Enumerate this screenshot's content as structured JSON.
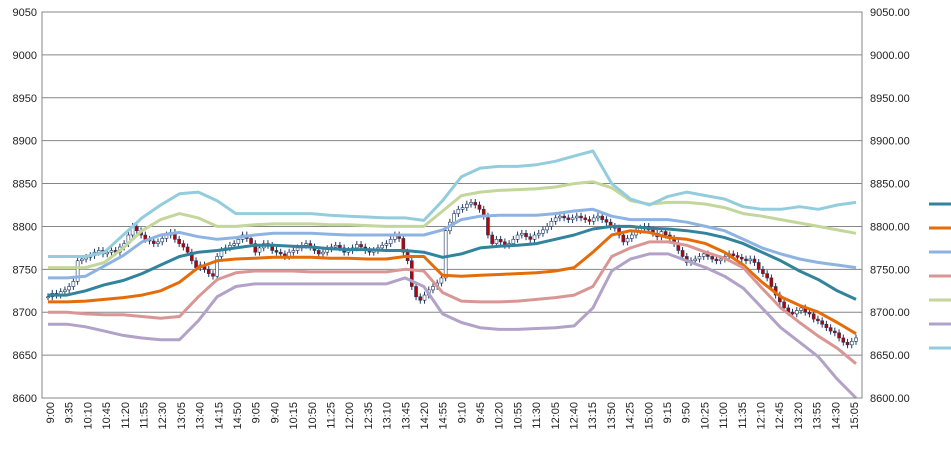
{
  "chart_data": {
    "type": "line",
    "title": "",
    "xlabel": "",
    "ylabel": "",
    "ylim": [
      8600,
      9050
    ],
    "grid": true,
    "legend": "right",
    "y_ticks_left": [
      "8600",
      "8650",
      "8700",
      "8750",
      "8800",
      "8850",
      "8900",
      "8950",
      "9000",
      "9050"
    ],
    "y_ticks_right": [
      "8600.00",
      "8650.00",
      "8700.00",
      "8750.00",
      "8800.00",
      "8850.00",
      "8900.00",
      "8950.00",
      "9000.00",
      "9050.00"
    ],
    "x_tick_labels": [
      "9:00",
      "9:35",
      "10:10",
      "10:45",
      "11:20",
      "11:55",
      "12:30",
      "13:05",
      "13:40",
      "14:15",
      "14:50",
      "9:05",
      "9:40",
      "10:15",
      "10:50",
      "11:25",
      "12:00",
      "12:35",
      "13:10",
      "13:45",
      "14:20",
      "14:55",
      "9:10",
      "9:45",
      "10:20",
      "10:55",
      "11:30",
      "12:05",
      "12:40",
      "13:15",
      "13:50",
      "14:25",
      "15:00",
      "9:15",
      "9:50",
      "10:25",
      "11:00",
      "11:35",
      "12:10",
      "12:45",
      "13:20",
      "13:55",
      "14:30",
      "15:05"
    ],
    "series": [
      {
        "color": "#31849b",
        "values": [
          8720,
          8720,
          8725,
          8732,
          8737,
          8745,
          8755,
          8765,
          8770,
          8772,
          8775,
          8778,
          8778,
          8777,
          8776,
          8774,
          8773,
          8773,
          8772,
          8772,
          8770,
          8764,
          8768,
          8775,
          8777,
          8778,
          8780,
          8785,
          8790,
          8797,
          8800,
          8800,
          8798,
          8797,
          8795,
          8792,
          8787,
          8780,
          8770,
          8760,
          8748,
          8738,
          8725,
          8715
        ]
      },
      {
        "color": "#e46c0a",
        "values": [
          8712,
          8712,
          8713,
          8715,
          8717,
          8720,
          8725,
          8735,
          8752,
          8760,
          8762,
          8763,
          8764,
          8764,
          8764,
          8763,
          8763,
          8762,
          8762,
          8765,
          8765,
          8743,
          8742,
          8743,
          8744,
          8745,
          8746,
          8748,
          8752,
          8770,
          8790,
          8795,
          8793,
          8787,
          8785,
          8780,
          8770,
          8755,
          8735,
          8718,
          8708,
          8700,
          8688,
          8675
        ]
      },
      {
        "color": "#8db3e2",
        "values": [
          8740,
          8740,
          8742,
          8754,
          8766,
          8782,
          8790,
          8793,
          8788,
          8785,
          8787,
          8790,
          8792,
          8792,
          8792,
          8791,
          8790,
          8790,
          8790,
          8790,
          8790,
          8796,
          8808,
          8812,
          8813,
          8813,
          8813,
          8815,
          8818,
          8820,
          8812,
          8808,
          8808,
          8808,
          8805,
          8800,
          8795,
          8785,
          8775,
          8768,
          8762,
          8758,
          8755,
          8752
        ]
      },
      {
        "color": "#d99694",
        "values": [
          8700,
          8700,
          8698,
          8697,
          8697,
          8695,
          8693,
          8695,
          8718,
          8738,
          8746,
          8748,
          8748,
          8748,
          8747,
          8747,
          8747,
          8747,
          8747,
          8750,
          8748,
          8723,
          8713,
          8712,
          8712,
          8713,
          8715,
          8717,
          8720,
          8730,
          8765,
          8775,
          8782,
          8782,
          8778,
          8770,
          8763,
          8752,
          8728,
          8705,
          8688,
          8672,
          8658,
          8640
        ]
      },
      {
        "color": "#c3d69b",
        "values": [
          8752,
          8752,
          8752,
          8758,
          8775,
          8795,
          8808,
          8815,
          8810,
          8800,
          8800,
          8802,
          8803,
          8803,
          8803,
          8802,
          8802,
          8801,
          8800,
          8800,
          8800,
          8818,
          8836,
          8840,
          8842,
          8843,
          8844,
          8846,
          8850,
          8852,
          8845,
          8830,
          8826,
          8828,
          8828,
          8826,
          8822,
          8815,
          8812,
          8808,
          8804,
          8800,
          8796,
          8792
        ]
      },
      {
        "color": "#b2a2c7",
        "values": [
          8686,
          8686,
          8683,
          8678,
          8673,
          8670,
          8668,
          8668,
          8690,
          8718,
          8730,
          8733,
          8733,
          8733,
          8733,
          8733,
          8733,
          8733,
          8733,
          8740,
          8730,
          8698,
          8688,
          8682,
          8680,
          8680,
          8681,
          8682,
          8684,
          8705,
          8748,
          8762,
          8768,
          8768,
          8760,
          8752,
          8742,
          8728,
          8705,
          8682,
          8665,
          8648,
          8622,
          8600
        ]
      },
      {
        "color": "#93cddd",
        "values": [
          8765,
          8765,
          8765,
          8770,
          8790,
          8810,
          8825,
          8838,
          8840,
          8830,
          8815,
          8815,
          8815,
          8815,
          8815,
          8813,
          8812,
          8811,
          8810,
          8810,
          8807,
          8830,
          8858,
          8868,
          8870,
          8870,
          8872,
          8876,
          8882,
          8888,
          8850,
          8832,
          8825,
          8835,
          8840,
          8836,
          8832,
          8823,
          8820,
          8820,
          8823,
          8820,
          8825,
          8828
        ]
      }
    ],
    "candles": [
      8718,
      8722,
      8720,
      8724,
      8726,
      8730,
      8736,
      8760,
      8762,
      8764,
      8766,
      8770,
      8772,
      8768,
      8770,
      8772,
      8770,
      8776,
      8780,
      8790,
      8800,
      8795,
      8790,
      8785,
      8783,
      8780,
      8782,
      8786,
      8790,
      8793,
      8785,
      8780,
      8776,
      8770,
      8760,
      8752,
      8755,
      8750,
      8745,
      8742,
      8765,
      8772,
      8775,
      8778,
      8780,
      8785,
      8790,
      8786,
      8780,
      8770,
      8775,
      8780,
      8778,
      8772,
      8770,
      8768,
      8765,
      8770,
      8772,
      8775,
      8778,
      8780,
      8776,
      8772,
      8768,
      8770,
      8774,
      8776,
      8778,
      8775,
      8770,
      8772,
      8775,
      8779,
      8776,
      8772,
      8770,
      8772,
      8775,
      8778,
      8780,
      8785,
      8790,
      8786,
      8770,
      8760,
      8730,
      8718,
      8714,
      8720,
      8726,
      8730,
      8734,
      8740,
      8795,
      8805,
      8815,
      8820,
      8822,
      8826,
      8828,
      8825,
      8820,
      8812,
      8790,
      8780,
      8785,
      8782,
      8778,
      8780,
      8785,
      8790,
      8792,
      8788,
      8785,
      8790,
      8792,
      8796,
      8800,
      8806,
      8810,
      8812,
      8810,
      8808,
      8810,
      8812,
      8810,
      8808,
      8806,
      8810,
      8812,
      8808,
      8805,
      8800,
      8798,
      8790,
      8782,
      8786,
      8790,
      8795,
      8798,
      8800,
      8796,
      8792,
      8788,
      8794,
      8790,
      8786,
      8780,
      8772,
      8765,
      8758,
      8760,
      8762,
      8765,
      8768,
      8765,
      8762,
      8760,
      8762,
      8765,
      8768,
      8766,
      8764,
      8762,
      8760,
      8762,
      8758,
      8750,
      8745,
      8740,
      8730,
      8720,
      8712,
      8705,
      8700,
      8698,
      8702,
      8705,
      8700,
      8698,
      8692,
      8690,
      8686,
      8682,
      8678,
      8676,
      8670,
      8665,
      8662,
      8666,
      8670
    ]
  }
}
